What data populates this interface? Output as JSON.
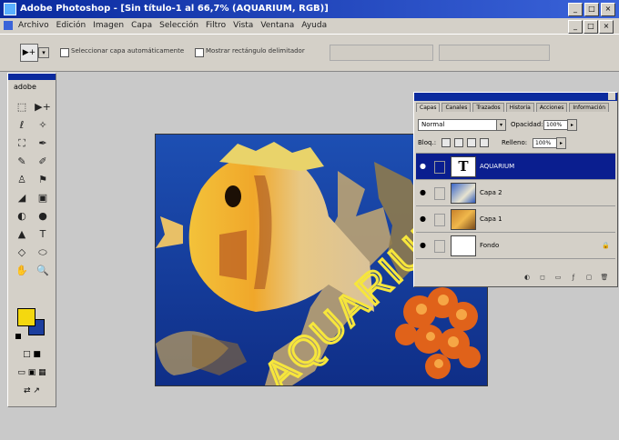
{
  "window": {
    "title": "Adobe Photoshop - [Sin título-1 al 66,7% (AQUARIUM, RGB)]",
    "controls": {
      "minimize": "_",
      "maximize": "□",
      "close": "×"
    }
  },
  "menu": [
    "Archivo",
    "Edición",
    "Imagen",
    "Capa",
    "Selección",
    "Filtro",
    "Vista",
    "Ventana",
    "Ayuda"
  ],
  "mdi_controls": [
    "_",
    "□",
    "×"
  ],
  "options_bar": {
    "tool_glyph": "▶+",
    "dropdown": "▾",
    "check1_label": "Seleccionar capa automáticamente",
    "check2_label": "Mostrar rectángulo delimitador"
  },
  "toolbox": {
    "logo": "adobe",
    "tools": [
      "⬚",
      "▶+",
      "ℓ",
      "✧",
      "⛶",
      "✒",
      "✎",
      "✐",
      "♙",
      "⚑",
      "◢",
      "▣",
      "◐",
      "●",
      "▲",
      "T",
      "◇",
      "⬭",
      "✋",
      "🔍"
    ],
    "bottom_row1": "□ ■",
    "bottom_row2": "▭ ▣ ▦",
    "bottom_row3": "⇄ ↗"
  },
  "colors": {
    "foreground": "#f4d80f",
    "background": "#1c3e9e",
    "accent": "#0a2a9e"
  },
  "canvas": {
    "text": "AQUARIUM"
  },
  "layers_panel": {
    "tabs": [
      "Capas",
      "Canales",
      "Trazados",
      "Historia",
      "Acciones",
      "Información"
    ],
    "blend_mode": "Normal",
    "opacity_label": "Opacidad:",
    "opacity_value": "100%",
    "lock_label": "Bloq.:",
    "fill_label": "Relleno:",
    "fill_value": "100%",
    "layers": [
      {
        "name": "AQUARIUM",
        "type": "text",
        "thumb": "T",
        "selected": true
      },
      {
        "name": "Capa 2",
        "type": "image",
        "thumb": "",
        "selected": false
      },
      {
        "name": "Capa 1",
        "type": "image",
        "thumb": "",
        "selected": false
      },
      {
        "name": "Fondo",
        "type": "background",
        "thumb": "",
        "selected": false,
        "lock": "🔒"
      }
    ],
    "footer_icons": [
      "◐",
      "◻",
      "▭",
      "ƒ",
      "▢",
      "🗑"
    ]
  }
}
